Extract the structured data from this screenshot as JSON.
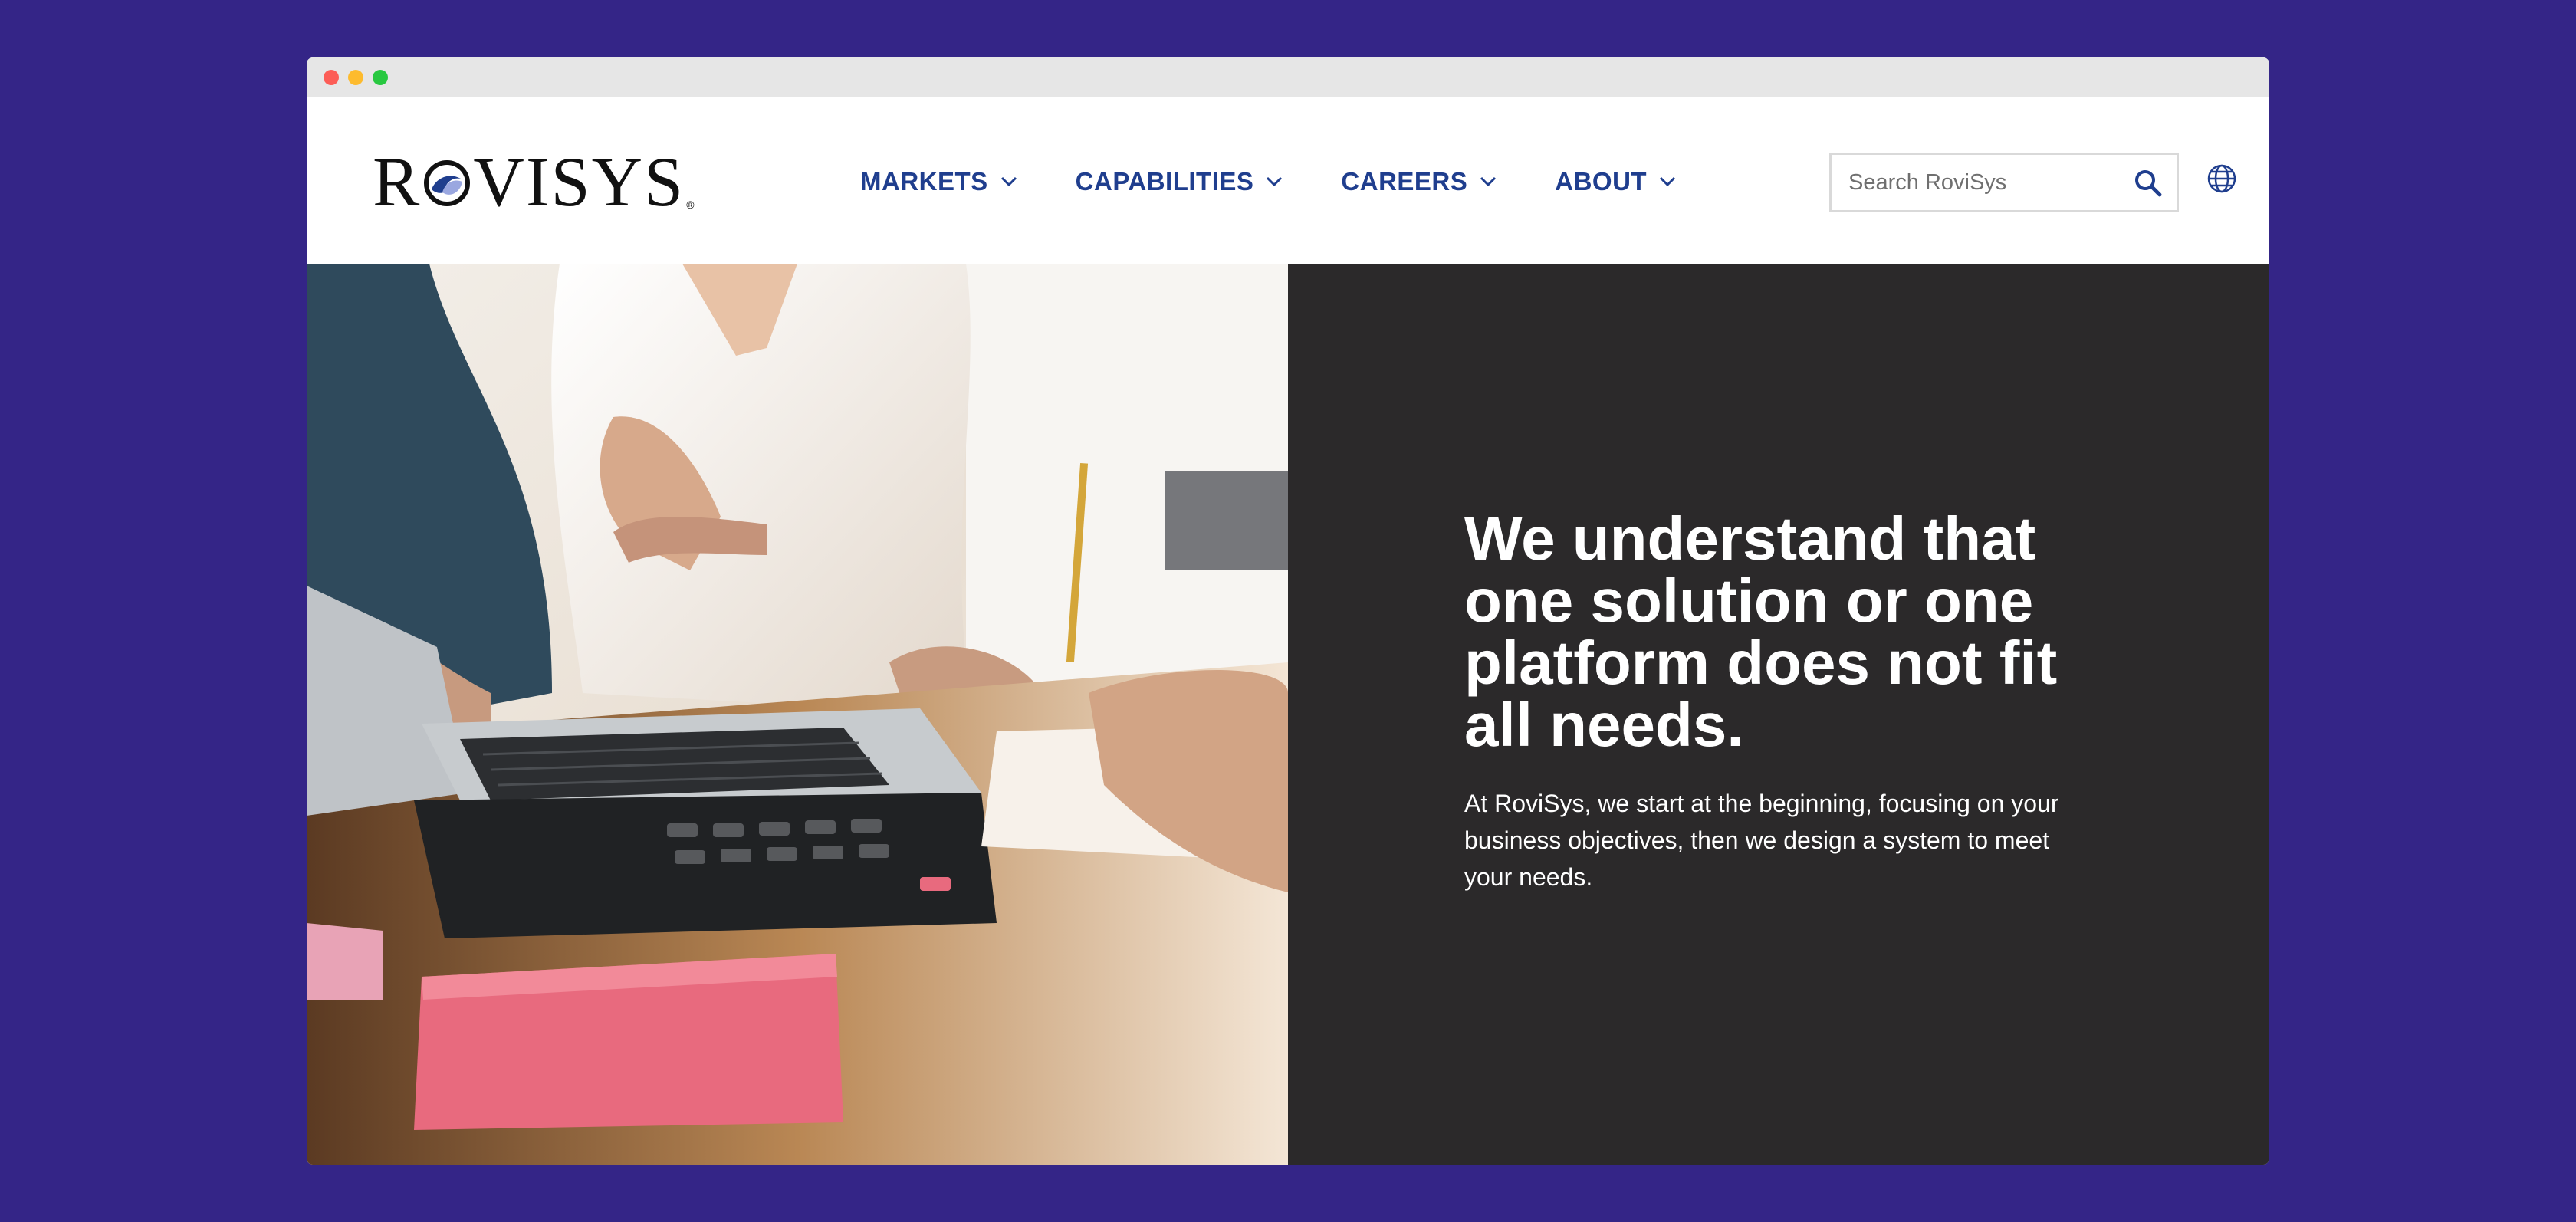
{
  "browser": {
    "window_controls": [
      "close",
      "minimize",
      "zoom"
    ]
  },
  "header": {
    "logo": {
      "text_before": "R",
      "text_after": "VISYS",
      "registered": "®",
      "brand_color": "#1f3e8e"
    },
    "nav": [
      {
        "label": "MARKETS",
        "icon": "chevron-down-icon"
      },
      {
        "label": "CAPABILITIES",
        "icon": "chevron-down-icon"
      },
      {
        "label": "CAREERS",
        "icon": "chevron-down-icon"
      },
      {
        "label": "ABOUT",
        "icon": "chevron-down-icon"
      }
    ],
    "search": {
      "placeholder": "Search RoviSys",
      "value": "",
      "icon": "search-icon"
    },
    "language_icon": "globe-icon"
  },
  "hero": {
    "headline": "We understand that one solution or one platform does not fit all needs.",
    "body": "At RoviSys, we start at the beginning, focusing on your business objectives, then we design a system to meet your needs.",
    "panel_color": "#2b292a"
  },
  "colors": {
    "page_background": "#342587",
    "nav_text": "#1f3e8e",
    "accent_pink": "#e86a7e"
  }
}
